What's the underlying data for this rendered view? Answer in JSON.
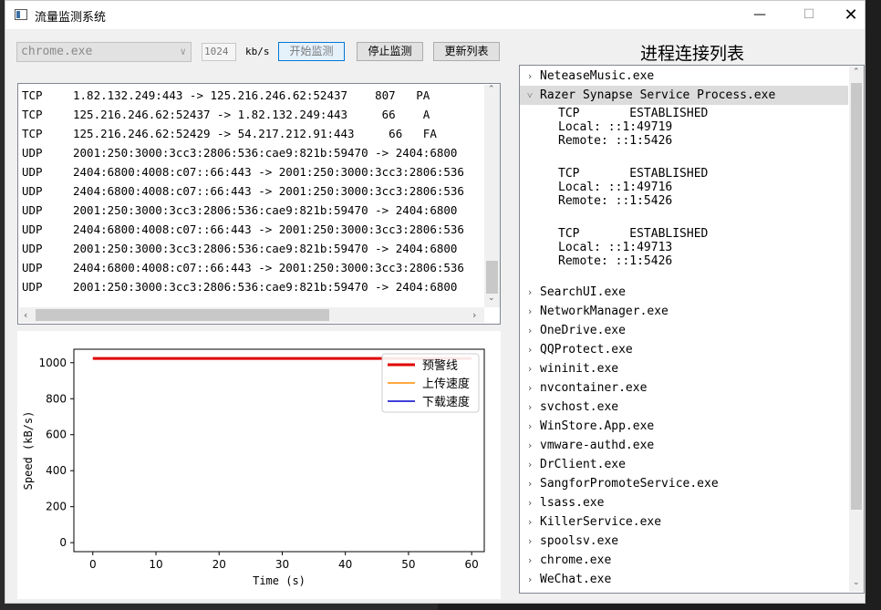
{
  "window": {
    "title": "流量监测系统"
  },
  "controls": {
    "process_select_value": "chrome.exe",
    "limit_value": "1024",
    "limit_unit": "kb/s",
    "start_label": "开始监测",
    "stop_label": "停止监测",
    "refresh_label": "更新列表"
  },
  "packets": [
    {
      "proto": "TCP",
      "text": "1.82.132.249:443 -> 125.216.246.62:52437    807   PA"
    },
    {
      "proto": "TCP",
      "text": "125.216.246.62:52437 -> 1.82.132.249:443     66    A"
    },
    {
      "proto": "TCP",
      "text": "125.216.246.62:52429 -> 54.217.212.91:443     66   FA"
    },
    {
      "proto": "UDP",
      "text": "2001:250:3000:3cc3:2806:536:cae9:821b:59470 -> 2404:6800"
    },
    {
      "proto": "UDP",
      "text": "2404:6800:4008:c07::66:443 -> 2001:250:3000:3cc3:2806:536"
    },
    {
      "proto": "UDP",
      "text": "2404:6800:4008:c07::66:443 -> 2001:250:3000:3cc3:2806:536"
    },
    {
      "proto": "UDP",
      "text": "2001:250:3000:3cc3:2806:536:cae9:821b:59470 -> 2404:6800"
    },
    {
      "proto": "UDP",
      "text": "2404:6800:4008:c07::66:443 -> 2001:250:3000:3cc3:2806:536"
    },
    {
      "proto": "UDP",
      "text": "2001:250:3000:3cc3:2806:536:cae9:821b:59470 -> 2404:6800"
    },
    {
      "proto": "UDP",
      "text": "2404:6800:4008:c07::66:443 -> 2001:250:3000:3cc3:2806:536"
    },
    {
      "proto": "UDP",
      "text": "2001:250:3000:3cc3:2806:536:cae9:821b:59470 -> 2404:6800"
    }
  ],
  "chart_data": {
    "type": "line",
    "title": "",
    "xlabel": "Time (s)",
    "ylabel": "Speed (kB/s)",
    "xlim": [
      -3,
      62
    ],
    "ylim": [
      -50,
      1075
    ],
    "xticks": [
      0,
      10,
      20,
      30,
      40,
      50,
      60
    ],
    "yticks": [
      0,
      200,
      400,
      600,
      800,
      1000
    ],
    "legend_position": "top-right",
    "series": [
      {
        "name": "预警线",
        "color": "#e00000",
        "x": [
          0,
          60
        ],
        "y": [
          1024,
          1024
        ]
      },
      {
        "name": "上传速度",
        "color": "#ff8c00",
        "x": [],
        "y": []
      },
      {
        "name": "下载速度",
        "color": "#0000cc",
        "x": [],
        "y": []
      }
    ]
  },
  "process_list": {
    "title": "进程连接列表",
    "items_before": [
      {
        "name": "NeteaseMusic.exe"
      }
    ],
    "expanded": {
      "name": "Razer Synapse Service Process.exe",
      "connections": [
        {
          "line": "TCP       ESTABLISHED",
          "local": "Local: ::1:49719",
          "remote": "Remote: ::1:5426"
        },
        {
          "line": "TCP       ESTABLISHED",
          "local": "Local: ::1:49716",
          "remote": "Remote: ::1:5426"
        },
        {
          "line": "TCP       ESTABLISHED",
          "local": "Local: ::1:49713",
          "remote": "Remote: ::1:5426"
        }
      ]
    },
    "items_after": [
      {
        "name": "SearchUI.exe"
      },
      {
        "name": "NetworkManager.exe"
      },
      {
        "name": "OneDrive.exe"
      },
      {
        "name": "QQProtect.exe"
      },
      {
        "name": "wininit.exe"
      },
      {
        "name": "nvcontainer.exe"
      },
      {
        "name": "svchost.exe"
      },
      {
        "name": "WinStore.App.exe"
      },
      {
        "name": "vmware-authd.exe"
      },
      {
        "name": "DrClient.exe"
      },
      {
        "name": "SangforPromoteService.exe"
      },
      {
        "name": "lsass.exe"
      },
      {
        "name": "KillerService.exe"
      },
      {
        "name": "spoolsv.exe"
      },
      {
        "name": "chrome.exe"
      },
      {
        "name": "WeChat.exe"
      }
    ]
  }
}
